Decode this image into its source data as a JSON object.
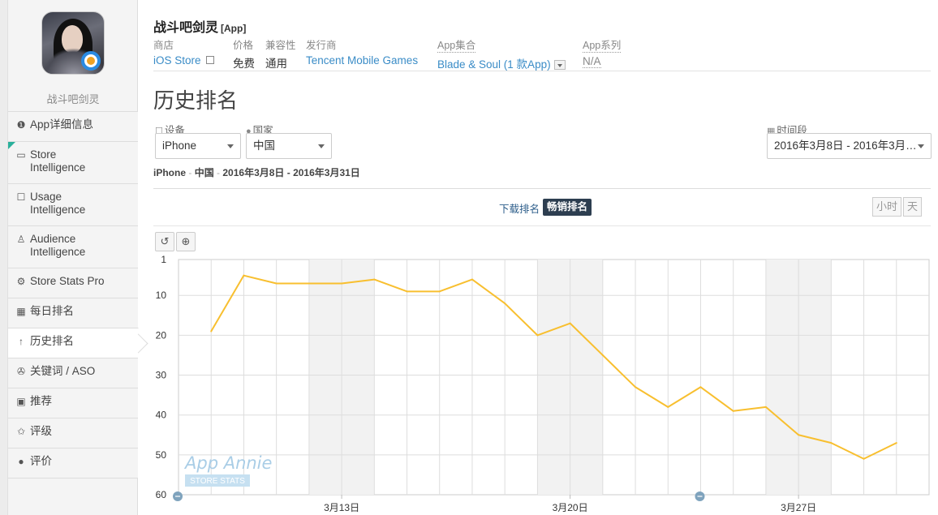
{
  "sidebar": {
    "app_name": "战斗吧剑灵",
    "items": [
      {
        "label": "App详细信息",
        "icon": "info-circle-icon",
        "glyph": "❶"
      },
      {
        "label": "Store\nIntelligence",
        "icon": "store-icon",
        "glyph": "▭"
      },
      {
        "label": "Usage\nIntelligence",
        "icon": "phone-hand-icon",
        "glyph": "☐"
      },
      {
        "label": "Audience\nIntelligence",
        "icon": "person-icon",
        "glyph": "♙"
      },
      {
        "label": "Store Stats Pro",
        "icon": "cog-icon",
        "glyph": "⚙"
      },
      {
        "label": "每日排名",
        "icon": "calendar-icon",
        "glyph": "▦"
      },
      {
        "label": "历史排名",
        "icon": "arrow-up-icon",
        "glyph": "↑"
      },
      {
        "label": "关键词 / ASO",
        "icon": "keyword-icon",
        "glyph": "✇"
      },
      {
        "label": "推荐",
        "icon": "bookmark-icon",
        "glyph": "▣"
      },
      {
        "label": "评级",
        "icon": "star-icon",
        "glyph": "✩"
      },
      {
        "label": "评价",
        "icon": "comment-icon",
        "glyph": "●"
      }
    ],
    "accent_color": "#2ab09b"
  },
  "header": {
    "title": "战斗吧剑灵",
    "tag": "[App]",
    "store_label": "商店",
    "store_value": "iOS Store",
    "price_label": "价格",
    "price_value": "免费",
    "compat_label": "兼容性",
    "compat_value": "通用",
    "publisher_label": "发行商",
    "publisher_value": "Tencent Mobile Games",
    "collection_label": "App集合",
    "collection_value": "Blade & Soul (1 款App)",
    "series_label": "App系列",
    "series_value": "N/A",
    "link_color": "#3a8cc7"
  },
  "page": {
    "title": "历史排名",
    "device_label": "设备",
    "device_value": "iPhone",
    "country_label": "国家",
    "country_value": "中国",
    "period_label": "时间段",
    "period_value": "2016年3月8日 - 2016年3月…",
    "summary_device": "iPhone",
    "summary_country": "中国",
    "summary_range": "2016年3月8日 - 2016年3月31日",
    "sep": " - ",
    "tab_download": "下载排名",
    "tab_grossing": "畅销排名",
    "hour_btn": "小时",
    "day_btn": "天",
    "reset_icon": "reset-icon",
    "zoom_icon": "zoom-in-icon"
  },
  "chart_data": {
    "type": "line",
    "x": [
      "2016-03-09",
      "2016-03-10",
      "2016-03-11",
      "2016-03-12",
      "2016-03-13",
      "2016-03-14",
      "2016-03-15",
      "2016-03-16",
      "2016-03-17",
      "2016-03-18",
      "2016-03-19",
      "2016-03-20",
      "2016-03-21",
      "2016-03-22",
      "2016-03-23",
      "2016-03-24",
      "2016-03-25",
      "2016-03-26",
      "2016-03-27",
      "2016-03-28",
      "2016-03-29",
      "2016-03-30"
    ],
    "values": [
      19,
      5,
      7,
      7,
      7,
      6,
      9,
      9,
      6,
      12,
      20,
      17,
      25,
      33,
      38,
      33,
      39,
      38,
      45,
      47,
      51,
      47
    ],
    "y_ticks": [
      "1",
      "10",
      "20",
      "30",
      "40",
      "50",
      "60"
    ],
    "x_tick_labels": [
      "3月13日",
      "3月20日",
      "3月27日"
    ],
    "ylim": [
      1,
      60
    ],
    "y_inverted": true,
    "line_color": "#f8bf2f",
    "weekend_shading": true,
    "watermark": "App Annie",
    "watermark_sub": "STORE STATS"
  }
}
